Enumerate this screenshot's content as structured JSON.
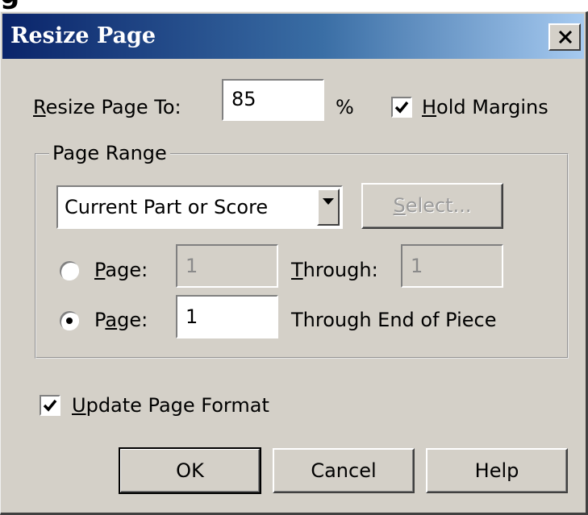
{
  "background_glyph": "g",
  "window": {
    "title": "Resize Page",
    "close_label": "X"
  },
  "resize": {
    "label": "Resize Page To:",
    "value": "85",
    "unit": "%",
    "hold_margins_label": "Hold Margins",
    "hold_margins_checked": true
  },
  "page_range": {
    "legend": "Page Range",
    "scope_selected": "Current Part or Score",
    "select_button": "Select...",
    "option1": {
      "label": "Page:",
      "from": "1",
      "through_label": "Through:",
      "to": "1",
      "selected": false
    },
    "option2": {
      "label": "Page:",
      "from": "1",
      "through_label": "Through End of Piece",
      "selected": true
    }
  },
  "update_format": {
    "label": "Update Page Format",
    "checked": true
  },
  "buttons": {
    "ok": "OK",
    "cancel": "Cancel",
    "help": "Help"
  }
}
